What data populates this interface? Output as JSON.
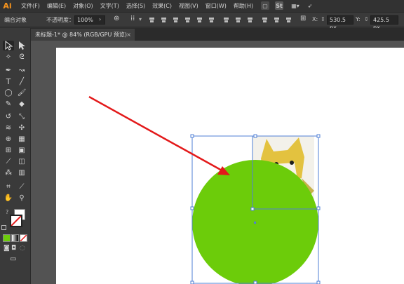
{
  "app": {
    "logo": "Ai"
  },
  "menu": [
    "文件(F)",
    "编辑(E)",
    "对象(O)",
    "文字(T)",
    "选择(S)",
    "效果(C)",
    "视图(V)",
    "窗口(W)",
    "帮助(H)"
  ],
  "menu_right": {
    "st_badge": "St"
  },
  "control_bar": {
    "selection_label": "编合对象",
    "opacity_label": "不透明度：",
    "opacity_value": "100%",
    "x_label": "X:",
    "x_value": "530.5 px",
    "y_label": "Y:",
    "y_value": "425.5 px"
  },
  "document_tab": {
    "title": "未标题-1* @ 84% (RGB/GPU 预览)",
    "close": "×"
  },
  "colors": {
    "circle_fill": "#6ccc0a",
    "arrow": "#e3191a",
    "selection": "#4f7fd6"
  },
  "icons": [
    "selection-tool-icon",
    "direct-selection-tool-icon",
    "magic-wand-icon",
    "lasso-icon",
    "pen-icon",
    "curvature-icon",
    "type-icon",
    "line-icon",
    "ellipse-icon",
    "paintbrush-icon",
    "shaper-icon",
    "eraser-icon",
    "rotate-icon",
    "scale-icon",
    "width-icon",
    "free-transform-icon",
    "shape-builder-icon",
    "perspective-icon",
    "mesh-icon",
    "gradient-icon",
    "eyedropper-icon",
    "blend-icon",
    "symbol-sprayer-icon",
    "column-graph-icon",
    "artboard-icon",
    "slice-icon",
    "hand-icon",
    "zoom-icon"
  ]
}
